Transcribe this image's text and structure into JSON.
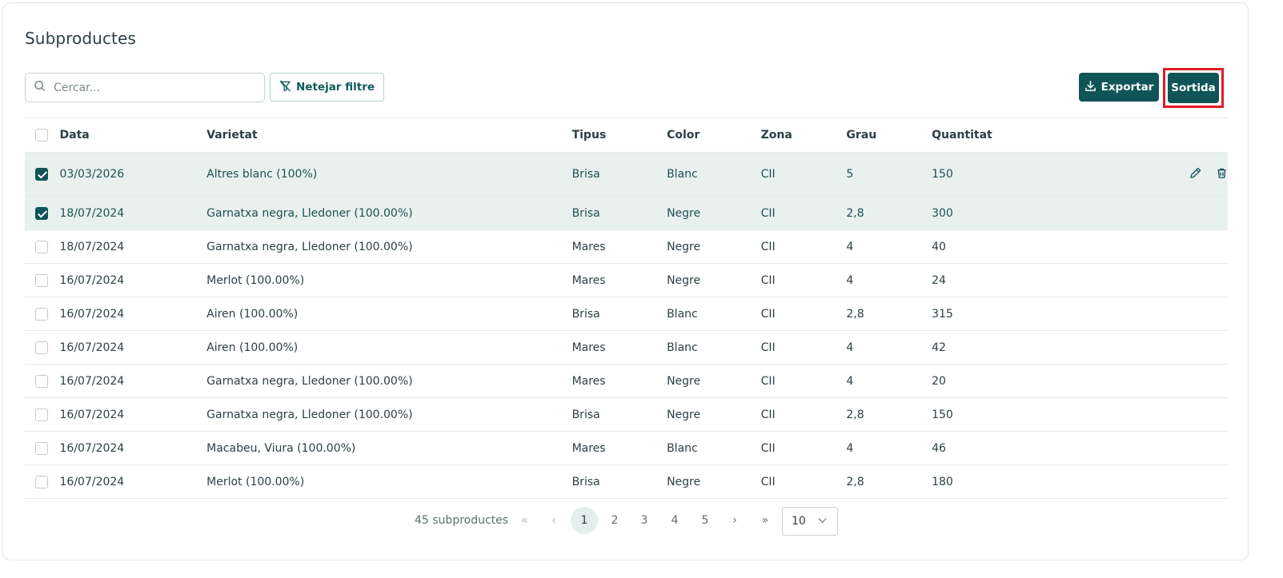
{
  "page": {
    "title": "Subproductes"
  },
  "toolbar": {
    "search_placeholder": "Cercar...",
    "clear_filter_label": "Netejar filtre",
    "export_label": "Exportar",
    "sortida_label": "Sortida"
  },
  "table": {
    "columns": [
      "Data",
      "Varietat",
      "Tipus",
      "Color",
      "Zona",
      "Grau",
      "Quantitat"
    ],
    "rows": [
      {
        "checked": true,
        "data": "03/03/2026",
        "varietat": "Altres blanc (100%)",
        "tipus": "Brisa",
        "color": "Blanc",
        "zona": "CII",
        "grau": "5",
        "quantitat": "150"
      },
      {
        "checked": true,
        "data": "18/07/2024",
        "varietat": "Garnatxa negra, Lledoner (100.00%)",
        "tipus": "Brisa",
        "color": "Negre",
        "zona": "CII",
        "grau": "2,8",
        "quantitat": "300"
      },
      {
        "checked": false,
        "data": "18/07/2024",
        "varietat": "Garnatxa negra, Lledoner (100.00%)",
        "tipus": "Mares",
        "color": "Negre",
        "zona": "CII",
        "grau": "4",
        "quantitat": "40"
      },
      {
        "checked": false,
        "data": "16/07/2024",
        "varietat": "Merlot (100.00%)",
        "tipus": "Mares",
        "color": "Negre",
        "zona": "CII",
        "grau": "4",
        "quantitat": "24"
      },
      {
        "checked": false,
        "data": "16/07/2024",
        "varietat": "Airen (100.00%)",
        "tipus": "Brisa",
        "color": "Blanc",
        "zona": "CII",
        "grau": "2,8",
        "quantitat": "315"
      },
      {
        "checked": false,
        "data": "16/07/2024",
        "varietat": "Airen (100.00%)",
        "tipus": "Mares",
        "color": "Blanc",
        "zona": "CII",
        "grau": "4",
        "quantitat": "42"
      },
      {
        "checked": false,
        "data": "16/07/2024",
        "varietat": "Garnatxa negra, Lledoner (100.00%)",
        "tipus": "Mares",
        "color": "Negre",
        "zona": "CII",
        "grau": "4",
        "quantitat": "20"
      },
      {
        "checked": false,
        "data": "16/07/2024",
        "varietat": "Garnatxa negra, Lledoner (100.00%)",
        "tipus": "Brisa",
        "color": "Negre",
        "zona": "CII",
        "grau": "2,8",
        "quantitat": "150"
      },
      {
        "checked": false,
        "data": "16/07/2024",
        "varietat": "Macabeu, Viura (100.00%)",
        "tipus": "Mares",
        "color": "Blanc",
        "zona": "CII",
        "grau": "4",
        "quantitat": "46"
      },
      {
        "checked": false,
        "data": "16/07/2024",
        "varietat": "Merlot (100.00%)",
        "tipus": "Brisa",
        "color": "Negre",
        "zona": "CII",
        "grau": "2,8",
        "quantitat": "180"
      }
    ]
  },
  "pagination": {
    "total_label": "45 subproductes",
    "pages": [
      "1",
      "2",
      "3",
      "4",
      "5"
    ],
    "current_page": "1",
    "first": "«",
    "prev": "‹",
    "next": "›",
    "last": "»",
    "page_size": "10"
  },
  "icons": {
    "search": "search-icon",
    "filter_clear": "filter-off-icon",
    "export": "download-icon",
    "edit": "pencil-icon",
    "delete": "trash-icon",
    "dropdown": "chevron-down-icon"
  },
  "colors": {
    "accent": "#0f5558",
    "selected_row": "#e9f1ef",
    "highlight": "#e21b23"
  }
}
